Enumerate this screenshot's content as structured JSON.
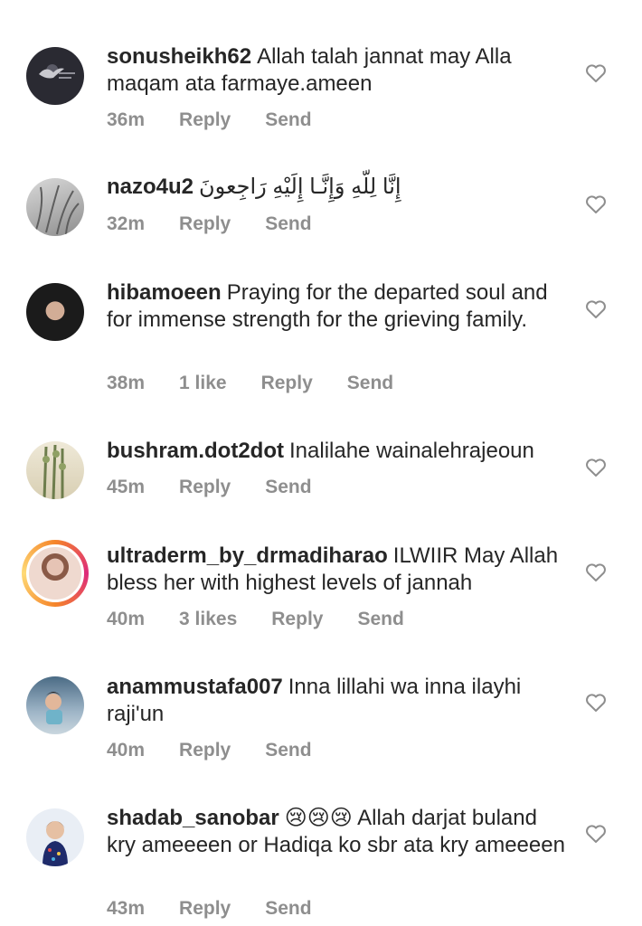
{
  "comments": [
    {
      "username": "sonusheikh62",
      "text": "Allah talah jannat may Alla maqam ata farmaye.ameen",
      "time": "36m",
      "likes": "",
      "reply": "Reply",
      "send": "Send",
      "avatar": "dove-avatar",
      "avatar_colors": [
        "#1b1b1f",
        "#3a3a44"
      ]
    },
    {
      "username": "nazo4u2",
      "text": "إِنَّا لِلّهِ وَإِنَّـا إِلَيْهِ رَاجِعونَ",
      "time": "32m",
      "likes": "",
      "reply": "Reply",
      "send": "Send",
      "avatar": "grass-avatar",
      "avatar_colors": [
        "#9c9c9c",
        "#d6d6d6"
      ]
    },
    {
      "username": "hibamoeen",
      "text": "Praying for the departed soul and for immense strength for the grieving family.",
      "time": "38m",
      "likes": "1 like",
      "reply": "Reply",
      "send": "Send",
      "avatar": "portrait-avatar",
      "avatar_colors": [
        "#1a1a1a",
        "#c9a48e"
      ]
    },
    {
      "username": "bushram.dot2dot",
      "text": "Inalilahe wainalehrajeoun",
      "time": "45m",
      "likes": "",
      "reply": "Reply",
      "send": "Send",
      "avatar": "plant-avatar",
      "avatar_colors": [
        "#e8e2cf",
        "#6d7d4c"
      ]
    },
    {
      "username": "ultraderm_by_drmadiharao",
      "text": "ILWIIR May Allah bless her with highest levels of jannah",
      "time": "40m",
      "likes": "3 likes",
      "reply": "Reply",
      "send": "Send",
      "avatar": "story-ring-avatar",
      "avatar_colors": [
        "#efd9cf",
        "#8a5a47"
      ]
    },
    {
      "username": "anammustafa007",
      "text": "Inna lillahi wa inna ilayhi raji'un",
      "time": "40m",
      "likes": "",
      "reply": "Reply",
      "send": "Send",
      "avatar": "child-swing-avatar",
      "avatar_colors": [
        "#3d5f7a",
        "#b7c9d6"
      ]
    },
    {
      "username": "shadab_sanobar",
      "text": "😢😢😢 Allah darjat buland kry ameeeen or Hadiqa ko sbr ata kry ameeeen",
      "time": "43m",
      "likes": "",
      "reply": "Reply",
      "send": "Send",
      "avatar": "girl-avatar",
      "avatar_colors": [
        "#e9eef5",
        "#1f2b6b"
      ]
    }
  ]
}
